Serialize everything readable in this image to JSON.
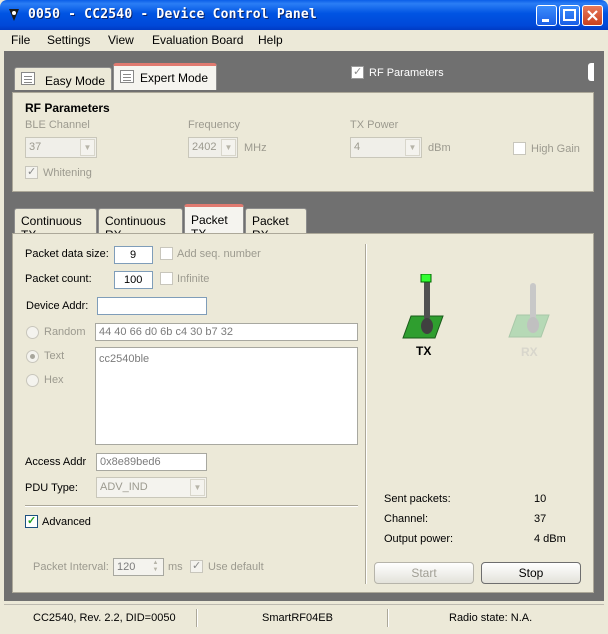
{
  "window": {
    "title": "0050 - CC2540 - Device Control Panel"
  },
  "menu": [
    {
      "label": "File"
    },
    {
      "label": "Settings"
    },
    {
      "label": "View"
    },
    {
      "label": "Evaluation Board"
    },
    {
      "label": "Help"
    }
  ],
  "mode_tabs": {
    "easy": "Easy Mode",
    "expert": "Expert Mode",
    "active": "Expert Mode"
  },
  "rf_toggle": {
    "label": "RF Parameters",
    "checked": true
  },
  "rf": {
    "heading": "RF Parameters",
    "ble_channel_label": "BLE Channel",
    "ble_channel_value": "37",
    "frequency_label": "Frequency",
    "frequency_value": "2402",
    "frequency_unit": "MHz",
    "tx_power_label": "TX Power",
    "tx_power_value": "4",
    "tx_power_unit": "dBm",
    "high_gain_label": "High Gain",
    "whitening_label": "Whitening"
  },
  "sub_tabs": [
    {
      "label": "Continuous TX"
    },
    {
      "label": "Continuous RX"
    },
    {
      "label": "Packet TX"
    },
    {
      "label": "Packet RX"
    }
  ],
  "packet_tx": {
    "data_size_label": "Packet data size:",
    "data_size_value": "9",
    "add_seq_label": "Add seq. number",
    "count_label": "Packet count:",
    "count_value": "100",
    "infinite_label": "Infinite",
    "device_addr_label": "Device Addr:",
    "device_addr_value": "",
    "random_label": "Random",
    "random_value": "44 40 66 d0 6b c4 30 b7 32",
    "text_label": "Text",
    "text_value": "cc2540ble",
    "hex_label": "Hex",
    "access_addr_label": "Access Addr",
    "access_addr_value": "0x8e89bed6",
    "pdu_type_label": "PDU Type:",
    "pdu_type_value": "ADV_IND",
    "advanced_label": "Advanced",
    "interval_label": "Packet Interval:",
    "interval_value": "120",
    "interval_unit": "ms",
    "use_default_label": "Use default"
  },
  "antenna": {
    "tx_label": "TX",
    "rx_label": "RX"
  },
  "stats": [
    {
      "label": "Sent packets:",
      "value": "10"
    },
    {
      "label": "Channel:",
      "value": "37"
    },
    {
      "label": "Output power:",
      "value": "4 dBm"
    }
  ],
  "buttons": {
    "start": "Start",
    "stop": "Stop"
  },
  "status": {
    "device": "CC2540, Rev. 2.2, DID=0050",
    "board": "SmartRF04EB",
    "radio": "Radio state: N.A."
  }
}
